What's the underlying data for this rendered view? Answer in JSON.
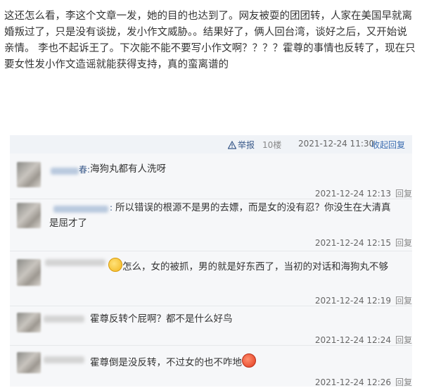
{
  "post": {
    "lines": [
      "这还怎么看，李这个文章一发，她的目的也达到了。网友被耍的团团转，人家在美国早就离",
      "婚叛过了，只是没有谈拢，发小作文威胁。。结果好了，俩人回台湾，谈好之后，又开始说",
      "亲情。 李也不起诉王了。下次能不能不要写小作文啊？？？？霍尊的事情也反转了，现在只",
      "要女性发小作文造谣就能获得支持，真的蛮离谱的"
    ]
  },
  "meta": {
    "report": "举报",
    "floor": "10楼",
    "time": "2021-12-24 11:30",
    "collapse": "收起回复"
  },
  "replies": [
    {
      "name_suffix": "春:",
      "text": "海狗丸都有人洗呀",
      "time": "2021-12-24 12:13",
      "reply_label": "回复"
    },
    {
      "name_suffix": ":",
      "text_line1": "所以错误的根源不是男的去嫖，而是女的没有忍？你没生在大清真",
      "text_line2": "是屈才了",
      "time": "2021-12-24 12:15",
      "reply_label": "回复"
    },
    {
      "text": "怎么，女的被抓，男的就是好东西了，当初的对话和海狗丸不够",
      "time": "2021-12-24 12:19",
      "reply_label": "回复",
      "emoji": "smiley"
    },
    {
      "text": "霍尊反转个屁啊？都不是什么好鸟",
      "time": "2021-12-24 12:24",
      "reply_label": "回复"
    },
    {
      "text": "霍尊倒是没反转，不过女的也不咋地",
      "time": "2021-12-24 12:26",
      "reply_label": "回复",
      "emoji": "angry"
    }
  ],
  "icons": {
    "report": "warning-triangle-icon"
  },
  "colors": {
    "link": "#3a6cb0",
    "reply_bg": "#f6f7f9",
    "meta_bg": "#f0f3f7"
  }
}
